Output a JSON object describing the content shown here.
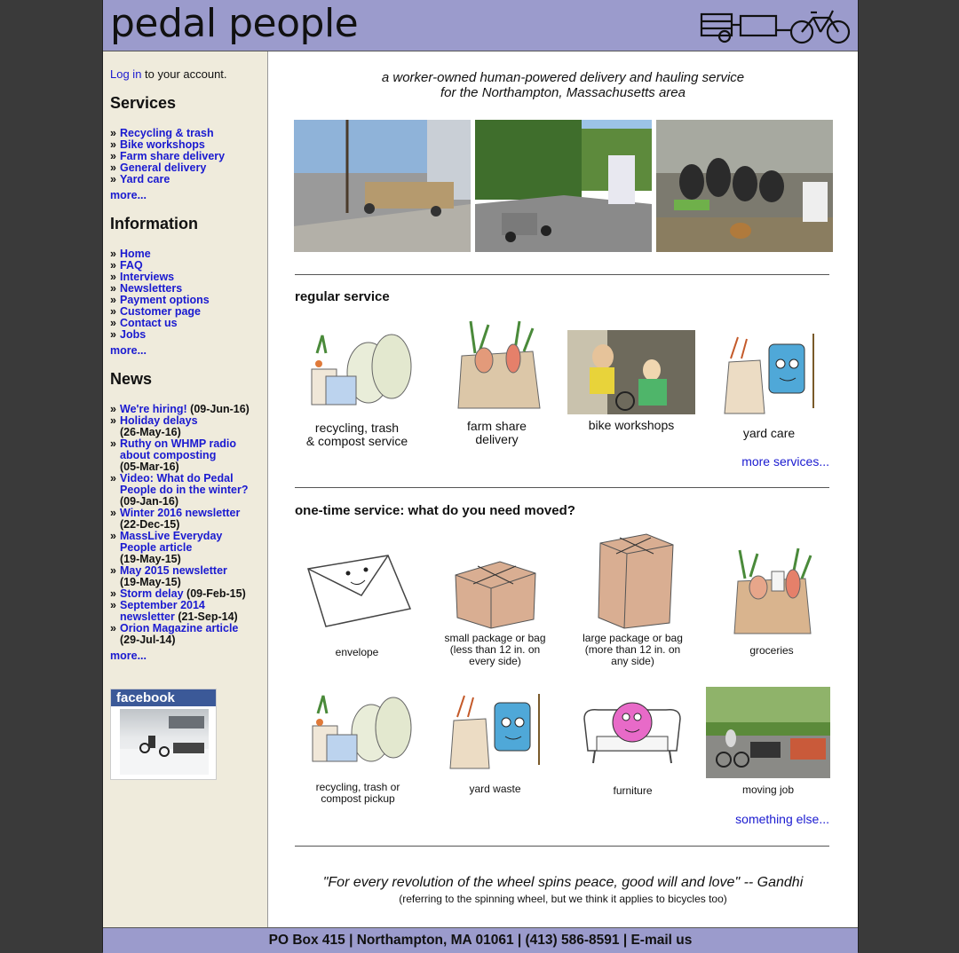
{
  "header": {
    "title": "pedal people",
    "logo_icon": "bike-trailer-icon"
  },
  "sidebar": {
    "login_link": "Log in",
    "login_suffix": " to your account.",
    "services_heading": "Services",
    "services": [
      "Recycling & trash",
      "Bike workshops",
      "Farm share delivery",
      "General delivery",
      "Yard care"
    ],
    "info_heading": "Information",
    "info": [
      "Home",
      "FAQ",
      "Interviews",
      "Newsletters",
      "Payment options",
      "Customer page",
      "Contact us",
      "Jobs"
    ],
    "news_heading": "News",
    "news": [
      {
        "title": "We're hiring!",
        "date": "(09-Jun-16)"
      },
      {
        "title": "Holiday delays",
        "date": "(26-May-16)"
      },
      {
        "title": "Ruthy on WHMP radio about composting",
        "date": "(05-Mar-16)"
      },
      {
        "title": "Video: What do Pedal People do in the winter?",
        "date": "(09-Jan-16)"
      },
      {
        "title": "Winter 2016 newsletter",
        "date": "(22-Dec-15)"
      },
      {
        "title": "MassLive Everyday People article",
        "date": "(19-May-15)"
      },
      {
        "title": "May 2015 newsletter",
        "date": "(19-May-15)"
      },
      {
        "title": "Storm delay",
        "date": "(09-Feb-15)"
      },
      {
        "title": "September 2014 newsletter",
        "date": "(21-Sep-14)"
      },
      {
        "title": "Orion Magazine article",
        "date": "(29-Jul-14)"
      }
    ],
    "more": "more...",
    "facebook": "facebook"
  },
  "main": {
    "tagline_1": "a worker-owned human-powered delivery and hauling service",
    "tagline_2": "for the Northampton, Massachusetts area",
    "regular_heading": "regular service",
    "regular": [
      {
        "l1": "recycling, trash",
        "l2": "& compost service"
      },
      {
        "l1": "farm share",
        "l2": "delivery"
      },
      {
        "l1": "bike workshops",
        "l2": ""
      },
      {
        "l1": "yard care",
        "l2": ""
      }
    ],
    "more_services": "more services...",
    "onetime_heading": "one-time service: what do you need moved?",
    "onetime": [
      {
        "l1": "envelope",
        "l2": "",
        "l3": ""
      },
      {
        "l1": "small package or bag",
        "l2": "(less than 12 in. on",
        "l3": "every side)"
      },
      {
        "l1": "large package or bag",
        "l2": "(more than 12 in. on",
        "l3": "any side)"
      },
      {
        "l1": "groceries",
        "l2": "",
        "l3": ""
      },
      {
        "l1": "recycling, trash or",
        "l2": "compost pickup",
        "l3": ""
      },
      {
        "l1": "yard waste",
        "l2": "",
        "l3": ""
      },
      {
        "l1": "furniture",
        "l2": "",
        "l3": ""
      },
      {
        "l1": "moving job",
        "l2": "",
        "l3": ""
      }
    ],
    "something_else": "something else...",
    "quote": "\"For every revolution of the wheel spins peace, good will and love\" -- Gandhi",
    "quote_note": "(referring to the spinning wheel, but we think it applies to bicycles too)"
  },
  "footer": {
    "text": "PO Box 415 | Northampton, MA 01061 | (413) 586-8591 | E-mail us"
  }
}
